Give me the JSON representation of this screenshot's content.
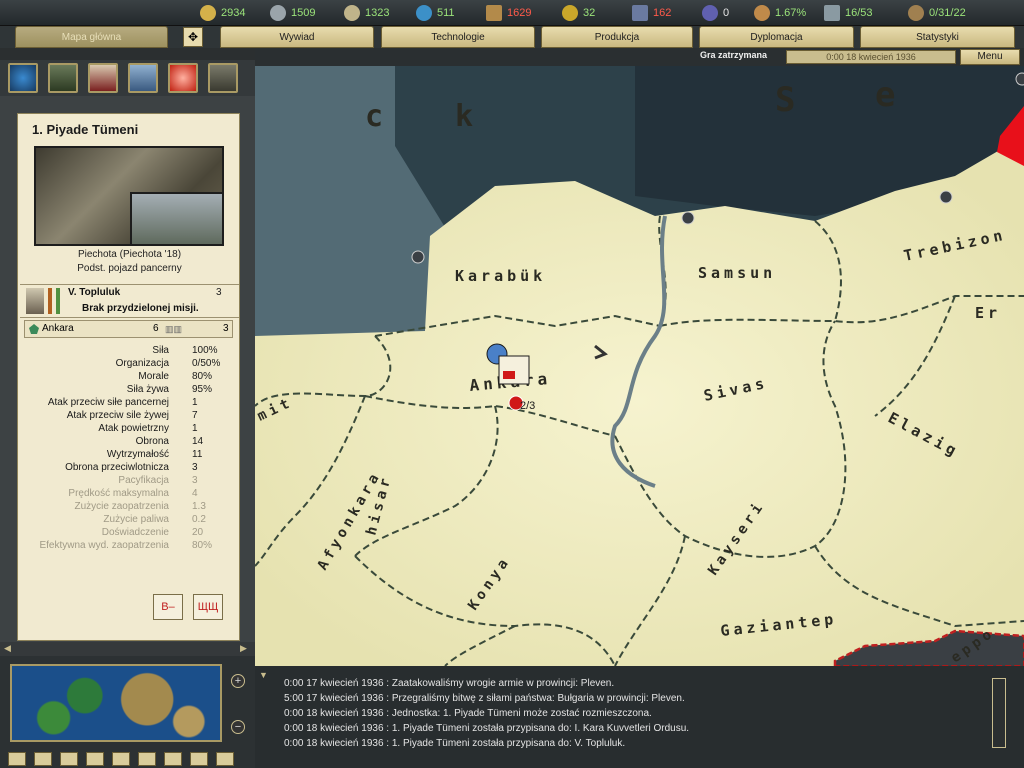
{
  "resources": [
    {
      "name": "energy",
      "value": "2934",
      "color": "#d4b14a"
    },
    {
      "name": "metal",
      "value": "1509",
      "color": "#9aa4aa"
    },
    {
      "name": "rare-materials",
      "value": "1323",
      "color": "#c0b48a"
    },
    {
      "name": "oil",
      "value": "511",
      "color": "#3c90c8"
    },
    {
      "name": "supplies",
      "value": "1629",
      "color": "#b38a4a",
      "red": true
    },
    {
      "name": "money",
      "value": "32",
      "color": "#caa72a"
    },
    {
      "name": "manpower",
      "value": "162",
      "color": "#6a7aa0",
      "red": true
    },
    {
      "name": "diplomacy",
      "value": "0",
      "color": "#6060b0",
      "white": true
    },
    {
      "name": "dissent",
      "value": "1.67%",
      "color": "#c08a4a"
    },
    {
      "name": "transports",
      "value": "16/53",
      "color": "#8a9aa2"
    },
    {
      "name": "convoys",
      "value": "0/31/22",
      "color": "#a08050"
    }
  ],
  "tabs": {
    "main_map": "Mapa główna",
    "intelligence": "Wywiad",
    "technology": "Technologie",
    "production": "Produkcja",
    "diplomacy": "Dyplomacja",
    "statistics": "Statystyki"
  },
  "status": {
    "paused": "Gra zatrzymana",
    "date": "0:00 18 kwiecień 1936",
    "menu": "Menu"
  },
  "unit": {
    "name": "1. Piyade Tümeni",
    "caption1": "Piechota (Piechota '18)",
    "caption2": "Podst. pojazd pancerny",
    "commander": "V. Topluluk",
    "commander_rank": "3",
    "mission": "Brak przydzielonej misji.",
    "location": "Ankara",
    "loc_num1": "6",
    "loc_num2": "3"
  },
  "stats": [
    {
      "label": "Siła",
      "value": "100%",
      "dim": false
    },
    {
      "label": "Organizacja",
      "value": "0/50%",
      "dim": false
    },
    {
      "label": "Morale",
      "value": "80%",
      "dim": false
    },
    {
      "label": "Siła żywa",
      "value": "95%",
      "dim": false
    },
    {
      "label": "Atak przeciw siłe pancernej",
      "value": "1",
      "dim": false
    },
    {
      "label": "Atak przeciw sile żywej",
      "value": "7",
      "dim": false
    },
    {
      "label": "Atak powietrzny",
      "value": "1",
      "dim": false
    },
    {
      "label": "Obrona",
      "value": "14",
      "dim": false
    },
    {
      "label": "Wytrzymałość",
      "value": "11",
      "dim": false
    },
    {
      "label": "Obrona przeciwlotnicza",
      "value": "3",
      "dim": false
    },
    {
      "label": "Pacyfikacja",
      "value": "3",
      "dim": true
    },
    {
      "label": "Prędkość maksymalna",
      "value": "4",
      "dim": true
    },
    {
      "label": "Zużycie zaopatrzenia",
      "value": "1.3",
      "dim": true
    },
    {
      "label": "Zużycie paliwa",
      "value": "0.2",
      "dim": true
    },
    {
      "label": "Doświadczenie",
      "value": "20",
      "dim": true
    },
    {
      "label": "Efektywna wyd. zaopatrzenia",
      "value": "80%",
      "dim": true
    }
  ],
  "actions": {
    "b_button": "B–",
    "unit_button": "ЩЩ"
  },
  "map": {
    "provinces": [
      "Karabük",
      "Samsun",
      "Trebizon",
      "Ankara",
      "Sivas",
      "Afyonkara",
      "hisar",
      "Konya",
      "Kayseri",
      "Elazig",
      "Gaziantep",
      "mit",
      "Er",
      "eppo"
    ],
    "sea": [
      "c",
      "k",
      "S",
      "e"
    ],
    "unit_count": "2/3"
  },
  "log": [
    "0:00 17 kwiecień 1936 : Zaatakowaliśmy wrogie armie w prowincji: Pleven.",
    "5:00 17 kwiecień 1936 : Przegraliśmy bitwę z siłami państwa: Bułgaria w prowincji: Pleven.",
    "0:00 18 kwiecień 1936 : Jednostka: 1. Piyade Tümeni może zostać rozmieszczona.",
    "0:00 18 kwiecień 1936 : 1. Piyade Tümeni została przypisana do: I. Kara Kuvvetleri Ordusu.",
    "0:00 18 kwiecień 1936 : 1. Piyade Tümeni została przypisana do: V. Topluluk."
  ],
  "minimap": {
    "zoom_in": "+",
    "zoom_out": "−"
  }
}
